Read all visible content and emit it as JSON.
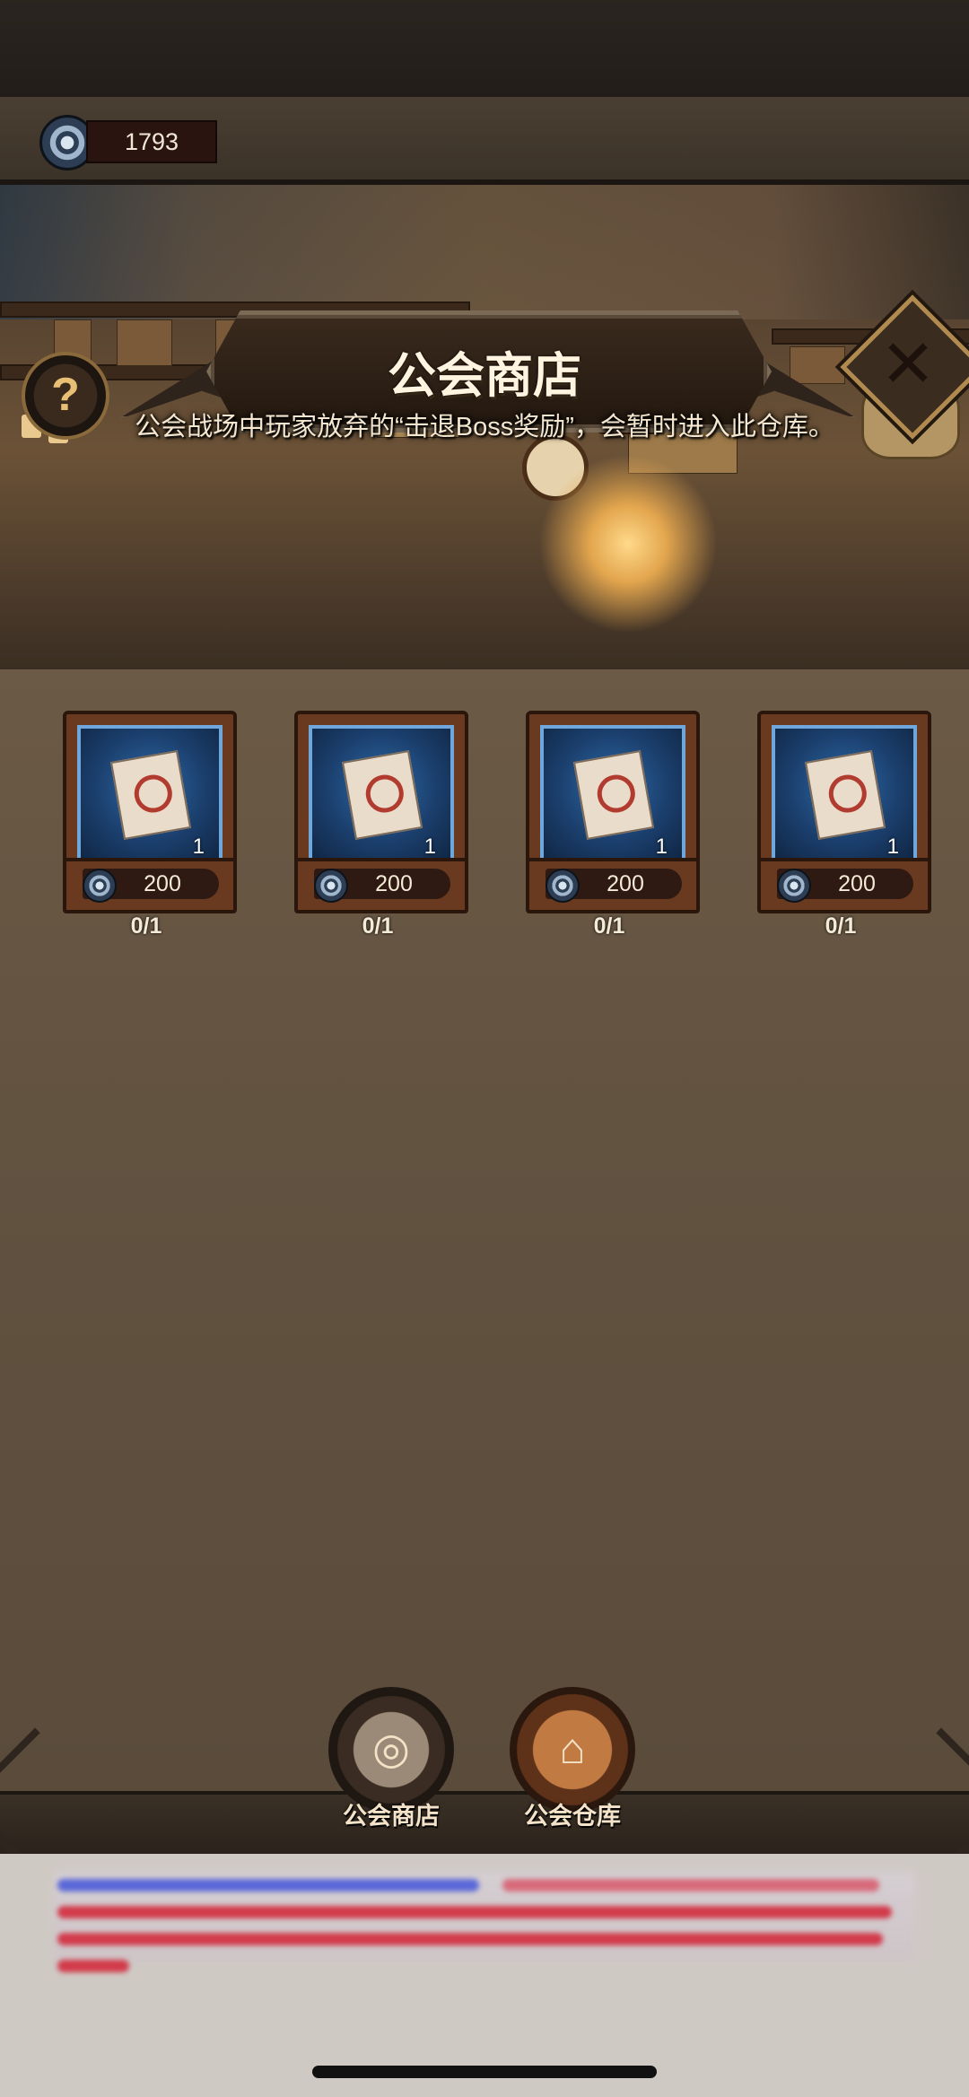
{
  "currency": {
    "amount": "1793",
    "icon": "guild-coin-icon"
  },
  "header": {
    "title": "公会商店",
    "help_icon": "question-icon",
    "close_icon": "close-icon"
  },
  "banner": {
    "text": "公会战场中玩家放弃的“击退Boss奖励”，会暂时进入此仓库。"
  },
  "items": [
    {
      "count": "1",
      "price": "200",
      "limit": "0/1",
      "icon": "boss-reward-scroll-icon"
    },
    {
      "count": "1",
      "price": "200",
      "limit": "0/1",
      "icon": "boss-reward-scroll-icon"
    },
    {
      "count": "1",
      "price": "200",
      "limit": "0/1",
      "icon": "boss-reward-scroll-icon"
    },
    {
      "count": "1",
      "price": "200",
      "limit": "0/1",
      "icon": "boss-reward-scroll-icon"
    }
  ],
  "tabs": [
    {
      "label": "公会商店",
      "icon": "guild-shop-icon"
    },
    {
      "label": "公会仓库",
      "icon": "guild-warehouse-icon"
    }
  ],
  "colors": {
    "coin": "#2c3f55",
    "item_bg": "#1b3f6d",
    "item_border": "#6fa6dc",
    "chat_text": "#cc1c2e",
    "chat_link": "#2e3fd0"
  }
}
